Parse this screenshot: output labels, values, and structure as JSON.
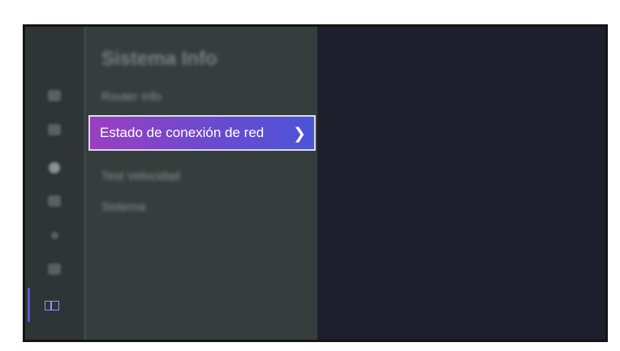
{
  "menu": {
    "title": "Sistema Info",
    "items": [
      {
        "label": "Router Info",
        "blurred": true
      },
      {
        "label": "Estado de conexión de red",
        "blurred": false,
        "selected": true
      },
      {
        "label": "Test Velocidad",
        "blurred": true
      },
      {
        "label": "Sistema",
        "blurred": true
      }
    ],
    "chevron_icon": "chevron-right-icon"
  },
  "rail": {
    "icons": [
      "picture-icon",
      "sound-icon",
      "network-icon",
      "channels-icon",
      "accessibility-icon",
      "apps-icon",
      "system-icon"
    ],
    "active_icon": "system-icon",
    "accent_color": "#4f5ad8"
  },
  "colors": {
    "selected_gradient_start": "#9a3fc0",
    "selected_gradient_end": "#4b55d8",
    "background": "#1f1e2c"
  }
}
